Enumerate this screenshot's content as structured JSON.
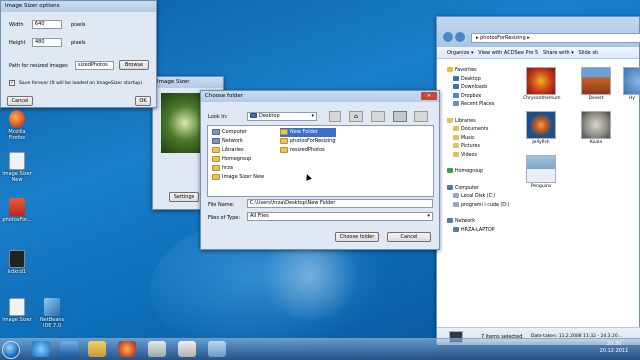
{
  "desktop": {
    "icons": [
      {
        "label": "Mozilla Firefox"
      },
      {
        "label": "Image Sizer New"
      },
      {
        "label": "photosFor..."
      },
      {
        "label": "kdxcd1"
      },
      {
        "label": "Image Sizer"
      },
      {
        "label": "NetBeans IDE 7.0"
      }
    ]
  },
  "options_dialog": {
    "title": "Image Sizer options",
    "width_label": "Width",
    "width_value": "640",
    "width_unit": "pixels",
    "height_label": "Height",
    "height_value": "480",
    "height_unit": "pixels",
    "path_label": "Path for resized images",
    "path_value": "sizedPhotos",
    "browse_label": "Browse",
    "save_label": "Save forever (It will be loaded on ImageSizer startup)",
    "cancel_label": "Cancel",
    "ok_label": "OK"
  },
  "sizer_window": {
    "title": "Image Sizer",
    "settings_label": "Settings"
  },
  "choose_folder": {
    "title": "Choose folder",
    "look_in_label": "Look In:",
    "look_in_value": "Desktop",
    "left_items": [
      "Computer",
      "Network",
      "Libraries",
      "Homegroup",
      "hrza",
      "Image Sizer New"
    ],
    "right_items": [
      "New Folder",
      "photosForResizing",
      "resizedPhotos"
    ],
    "file_name_label": "File Name:",
    "file_name_value": "C:\\Users\\hrza\\Desktop\\New Folder",
    "files_of_type_label": "Files of Type:",
    "files_of_type_value": "All Files",
    "choose_label": "Choose folder",
    "cancel_label": "Cancel"
  },
  "explorer": {
    "title": "photosForResizing",
    "toolbar": {
      "organize": "Organize",
      "view_acdsee": "View with ACDSee Pro 5",
      "share_with": "Share with",
      "slide_show": "Slide sh"
    },
    "nav": [
      "Favorites",
      "Desktop",
      "Downloads",
      "Dropbox",
      "Recent Places",
      "Libraries",
      "Documents",
      "Music",
      "Pictures",
      "Videos",
      "Homegroup",
      "Computer",
      "Local Disk (C:)",
      "programi i cuda (D:)",
      "Network",
      "HRZA-LAPTOP"
    ],
    "thumbnails": [
      {
        "label": "Chrysanthemum",
        "color": "#c63a1a"
      },
      {
        "label": "Desert",
        "color": "#c4662a"
      },
      {
        "label": "Hy",
        "color": "#3a74b4"
      },
      {
        "label": "Jellyfish",
        "color": "#1d4f8a"
      },
      {
        "label": "Koala",
        "color": "#8d8a84"
      },
      {
        "label": "Penguins",
        "color": "#7aa6c8"
      }
    ],
    "status": "7 items selected",
    "status_detail": "Date taken: 11.2.2008 11:32 - 24.3.20..."
  },
  "taskbar": {
    "time": "20:30",
    "date": "20.12.2011"
  }
}
